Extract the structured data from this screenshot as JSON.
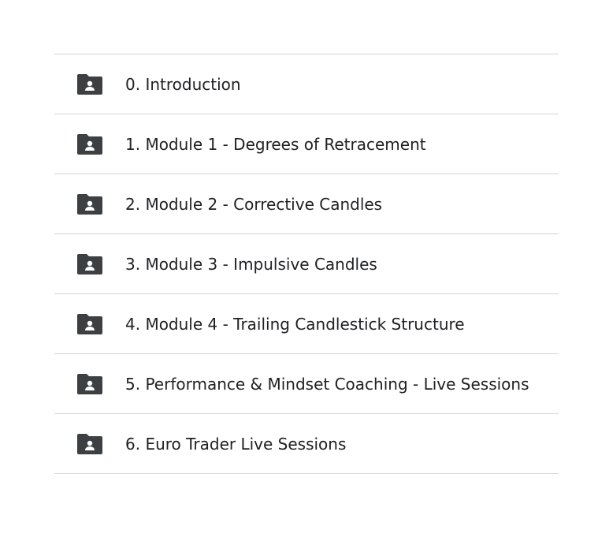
{
  "folders": [
    {
      "label": "0. Introduction",
      "icon": "shared-folder-icon"
    },
    {
      "label": "1. Module 1 - Degrees of Retracement",
      "icon": "shared-folder-icon"
    },
    {
      "label": "2. Module 2 - Corrective Candles",
      "icon": "shared-folder-icon"
    },
    {
      "label": "3. Module 3 - Impulsive Candles",
      "icon": "shared-folder-icon"
    },
    {
      "label": "4. Module 4 - Trailing Candlestick Structure",
      "icon": "shared-folder-icon"
    },
    {
      "label": "5. Performance & Mindset Coaching - Live Sessions",
      "icon": "shared-folder-icon"
    },
    {
      "label": "6. Euro Trader Live Sessions",
      "icon": "shared-folder-icon"
    }
  ],
  "colors": {
    "icon": "#3c4043",
    "text": "#202124",
    "divider": "#d3d3d3"
  }
}
